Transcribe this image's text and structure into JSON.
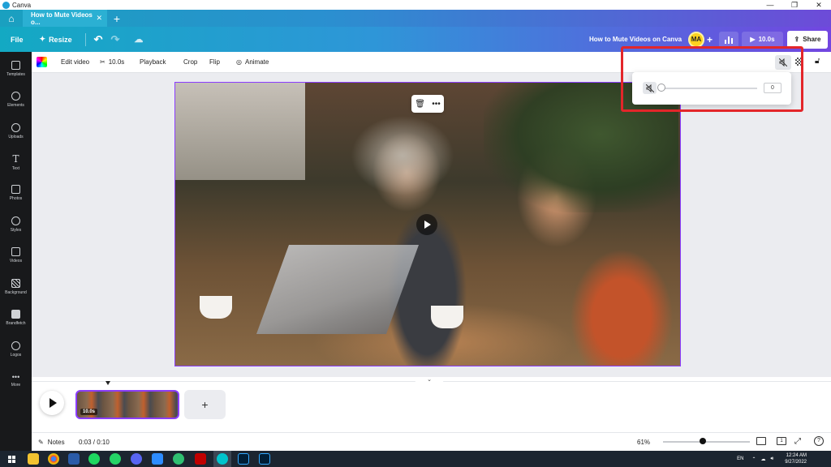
{
  "window": {
    "app_name": "Canva",
    "minimize": "—",
    "restore": "❐",
    "close": "✕"
  },
  "tabs": {
    "home_icon": "home-icon",
    "active_tab": "How to Mute Videos o...",
    "new_tab": "+"
  },
  "header": {
    "file_label": "File",
    "resize_label": "Resize",
    "design_title": "How to Mute Videos on Canva",
    "avatar_initials": "MA",
    "add_label": "+",
    "play_duration": "10.0s",
    "share_label": "Share",
    "gradient_start": "#13a9c3",
    "gradient_end": "#7246e0"
  },
  "sidebar": {
    "items": [
      {
        "label": "Templates",
        "icon": "templates-icon"
      },
      {
        "label": "Elements",
        "icon": "elements-icon"
      },
      {
        "label": "Uploads",
        "icon": "uploads-icon"
      },
      {
        "label": "Text",
        "icon": "text-icon"
      },
      {
        "label": "Photos",
        "icon": "photos-icon"
      },
      {
        "label": "Styles",
        "icon": "styles-icon"
      },
      {
        "label": "Videos",
        "icon": "videos-icon"
      },
      {
        "label": "Background",
        "icon": "background-icon"
      },
      {
        "label": "Brandfetch",
        "icon": "brandfetch-icon"
      },
      {
        "label": "Logos",
        "icon": "logos-icon"
      },
      {
        "label": "More",
        "icon": "more-icon"
      }
    ]
  },
  "toolbar": {
    "edit_video": "Edit video",
    "duration": "10.0s",
    "playback": "Playback",
    "crop": "Crop",
    "flip": "Flip",
    "animate": "Animate"
  },
  "volume_popup": {
    "value": "0",
    "level_percent": 0
  },
  "float_menu": {
    "trash_icon": "trash-icon",
    "more": "•••"
  },
  "timeline": {
    "clip_duration": "10.0s",
    "add": "+",
    "collapse": "⌄"
  },
  "bottom": {
    "notes_label": "Notes",
    "time": "0:03 / 0:10",
    "zoom": "61%",
    "page_count": "1"
  },
  "taskbar": {
    "lang": "EN",
    "time": "12:24 AM",
    "date": "9/27/2022"
  },
  "colors": {
    "selection": "#8b3dff",
    "highlight": "#e3262a",
    "sidebar_bg": "#18191b"
  }
}
